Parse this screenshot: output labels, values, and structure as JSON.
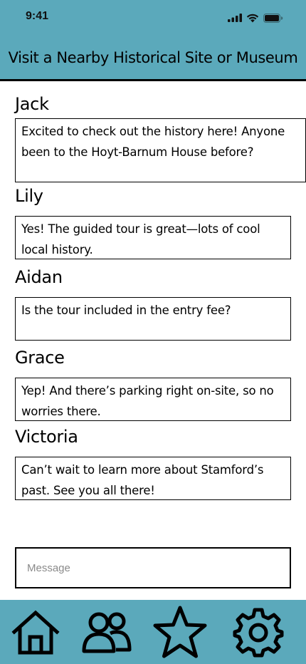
{
  "status_bar": {
    "time": "9:41"
  },
  "header": {
    "title": "Visit a Nearby Historical Site or Museum"
  },
  "messages": [
    {
      "author": "Jack",
      "text": "Excited to check out the history here! Anyone been to the Hoyt-Barnum House before?"
    },
    {
      "author": "Lily",
      "text": "Yes! The guided tour is great—lots of cool local history."
    },
    {
      "author": "Aidan",
      "text": "Is the tour included in the entry fee?"
    },
    {
      "author": "Grace",
      "text": "Yep! And there’s parking right on-site, so no worries there."
    },
    {
      "author": "Victoria",
      "text": "Can’t wait to learn more about Stamford’s past. See you all there!"
    }
  ],
  "composer": {
    "placeholder": "Message"
  },
  "bottom_nav": {
    "items": [
      {
        "icon": "home-icon"
      },
      {
        "icon": "people-icon"
      },
      {
        "icon": "star-icon"
      },
      {
        "icon": "gear-icon"
      }
    ]
  },
  "colors": {
    "accent": "#5ba9bb",
    "border": "#000000",
    "background": "#ffffff"
  }
}
